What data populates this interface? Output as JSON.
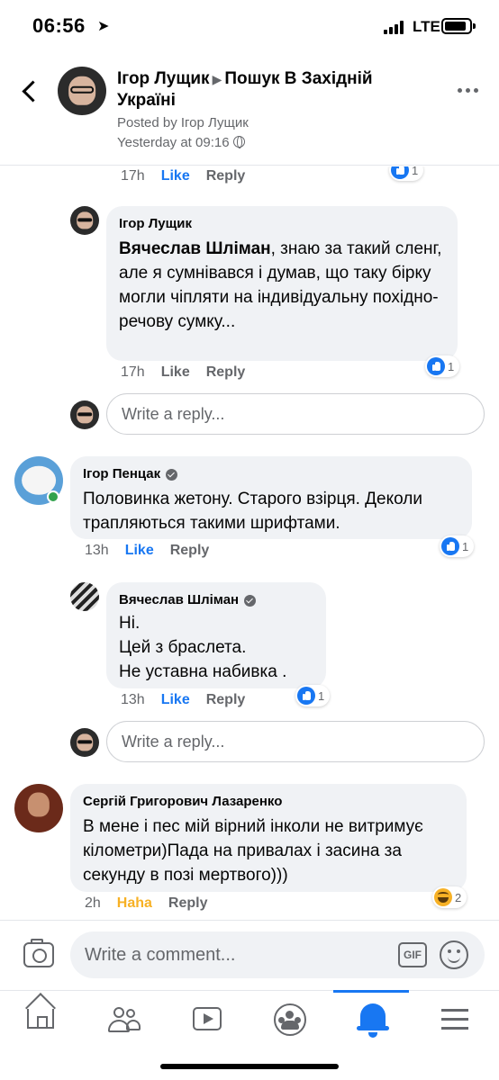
{
  "status_bar": {
    "time": "06:56",
    "network": "LTE"
  },
  "header": {
    "author": "Ігор Лущик",
    "group": "Пошук В Західній Україні",
    "posted_by": "Posted by Ігор Лущик",
    "timestamp": "Yesterday at 09:16",
    "icons": [
      "back-icon",
      "globe-icon",
      "more-icon"
    ]
  },
  "comments": {
    "top_partial": {
      "time": "17h",
      "like": "Like",
      "reply": "Reply",
      "reactions": "1"
    },
    "reply1": {
      "author": "Ігор Лущик",
      "mention": "Вячеслав Шліман",
      "text": ", знаю за такий сленг, але я сумнівався і думав, що таку бірку могли чіпляти на індивідуальну похідно-речову сумку...",
      "time": "17h",
      "like": "Like",
      "reply": "Reply",
      "reactions": "1"
    },
    "write_reply_placeholder": "Write a reply...",
    "c2": {
      "author": "Ігор Пенцак",
      "text": "Половинка жетону. Старого взірця. Деколи трапляються  такими шрифтами.",
      "time": "13h",
      "like": "Like",
      "reply": "Reply",
      "reactions": "1"
    },
    "c2_reply": {
      "author": "Вячеслав Шліман",
      "line1": "Ні.",
      "line2": "Цей з браслета.",
      "line3": "Не уставна набивка .",
      "time": "13h",
      "like": "Like",
      "reply": "Reply",
      "reactions": "1"
    },
    "c3": {
      "author": "Сергій Григорович Лазаренко",
      "text": "В мене і пес мій вірний інколи не витримує кілометри)Пада на привалах і засина за секунду в позі мертвого)))",
      "time": "2h",
      "reaction_label": "Haha",
      "reply": "Reply",
      "reactions": "2"
    }
  },
  "composer": {
    "placeholder": "Write a comment...",
    "gif": "GIF"
  },
  "nav": {
    "items": [
      "home",
      "friends",
      "watch",
      "groups",
      "notifications",
      "menu"
    ],
    "active": "notifications",
    "accent": "#1877f2"
  }
}
